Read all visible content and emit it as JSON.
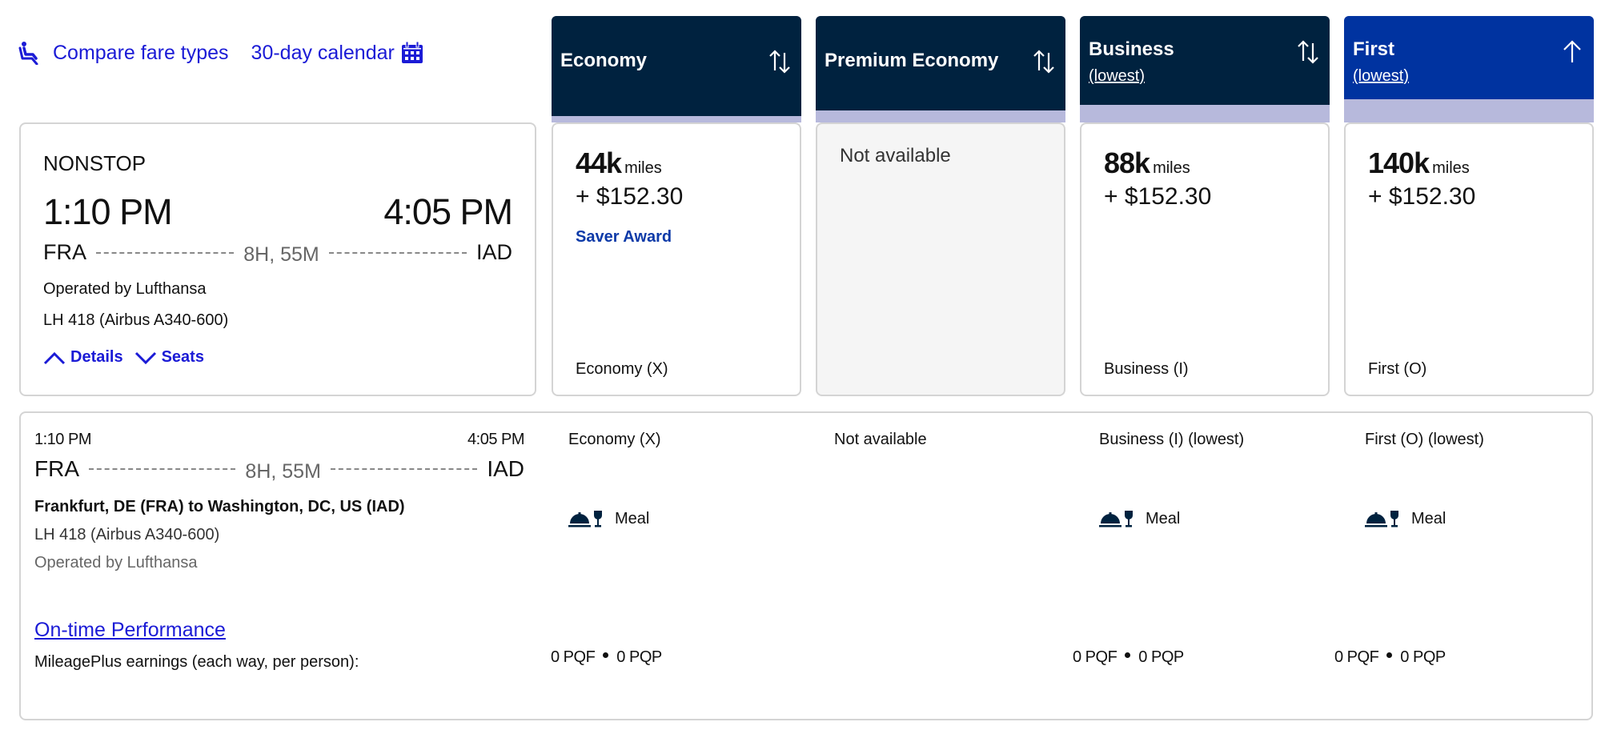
{
  "top_links": {
    "compare_fare_types": {
      "label": "Compare fare types",
      "icon": "seat-icon"
    },
    "calendar": {
      "label": "30-day calendar",
      "icon": "calendar-icon"
    }
  },
  "colors": {
    "link": "#1b1bd6",
    "header_dark": "#00223f",
    "header_selected": "#0033a0",
    "header_stripe": "#b7b9dc",
    "saver_award": "#0d3aa8",
    "unavailable_bg": "#f5f5f5"
  },
  "flight": {
    "stops": "NONSTOP",
    "depart_time": "1:10 PM",
    "arrive_time": "4:05 PM",
    "origin": "FRA",
    "destination": "IAD",
    "duration": "8H, 55M",
    "operated_by": "Operated by Lufthansa",
    "flight_number": "LH 418 (Airbus A340-600)",
    "details_label": "Details",
    "seats_label": "Seats"
  },
  "fares": [
    {
      "header": "Economy",
      "sub": "",
      "sort_icon": "sort-up-down-icon",
      "selected": false,
      "available": true,
      "miles": "44k",
      "miles_unit": "miles",
      "cash": "+ $152.30",
      "badge": "Saver Award",
      "fare_class": "Economy (X)"
    },
    {
      "header": "Premium Economy",
      "sub": "",
      "sort_icon": "sort-up-down-icon",
      "selected": false,
      "available": false,
      "status": "Not available"
    },
    {
      "header": "Business",
      "sub": "(lowest)",
      "sort_icon": "sort-up-down-icon",
      "selected": false,
      "available": true,
      "miles": "88k",
      "miles_unit": "miles",
      "cash": "+ $152.30",
      "badge": "",
      "fare_class": "Business (I)"
    },
    {
      "header": "First",
      "sub": "(lowest)",
      "sort_icon": "sort-up-icon",
      "selected": true,
      "available": true,
      "miles": "140k",
      "miles_unit": "miles",
      "cash": "+ $152.30",
      "badge": "",
      "fare_class": "First (O)"
    }
  ],
  "details": {
    "depart_time": "1:10 PM",
    "arrive_time": "4:05 PM",
    "origin": "FRA",
    "destination": "IAD",
    "duration": "8H, 55M",
    "cities": "Frankfurt, DE (FRA) to Washington, DC, US (IAD)",
    "flight_number": "LH 418 (Airbus A340-600)",
    "operated_by": "Operated by Lufthansa",
    "on_time_link": "On-time Performance",
    "earnings_label": "MileagePlus earnings (each way, per person):",
    "columns": [
      {
        "label": "Economy (X)",
        "meal": "Meal",
        "pqf": "0 PQF",
        "pqp": "0 PQP"
      },
      {
        "label": "Not available"
      },
      {
        "label": "Business (I) (lowest)",
        "meal": "Meal",
        "pqf": "0 PQF",
        "pqp": "0 PQP"
      },
      {
        "label": "First (O) (lowest)",
        "meal": "Meal",
        "pqf": "0 PQF",
        "pqp": "0 PQP"
      }
    ]
  }
}
